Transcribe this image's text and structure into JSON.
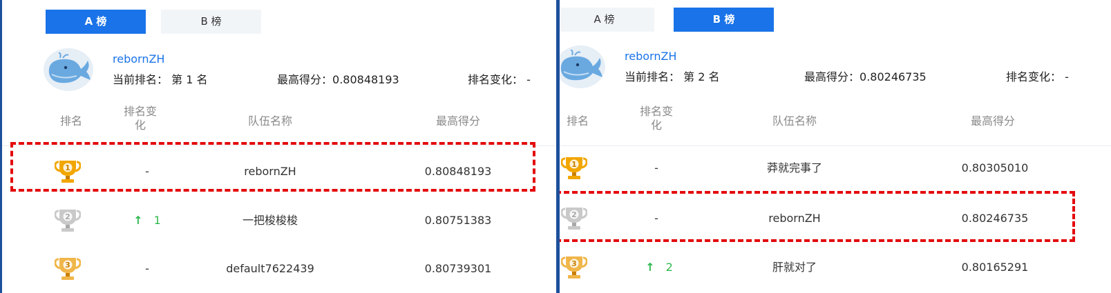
{
  "left": {
    "tabs": [
      {
        "label": "A 榜",
        "active": true
      },
      {
        "label": "B 榜",
        "active": false
      }
    ],
    "user": {
      "name": "rebornZH",
      "rank_label": "当前排名：",
      "rank_value": "第 1 名",
      "best_label": "最高得分：",
      "best_value": "0.80848193",
      "change_label": "排名变化：",
      "change_value": "-"
    },
    "headers": {
      "rank": "排名",
      "change_line1": "排名变",
      "change_line2": "化",
      "team": "队伍名称",
      "score": "最高得分"
    },
    "rows": [
      {
        "medal": "gold",
        "medal_number": "1",
        "change_arrow": "",
        "change": "-",
        "team": "rebornZH",
        "score": "0.80848193"
      },
      {
        "medal": "silver",
        "medal_number": "2",
        "change_arrow": "↑",
        "change": "1",
        "team": "一把梭梭梭",
        "score": "0.80751383"
      },
      {
        "medal": "bronze",
        "medal_number": "3",
        "change_arrow": "",
        "change": "-",
        "team": "default7622439",
        "score": "0.80739301"
      }
    ]
  },
  "right": {
    "tabs": [
      {
        "label": "A 榜",
        "active": false
      },
      {
        "label": "B 榜",
        "active": true
      }
    ],
    "user": {
      "name": "rebornZH",
      "rank_label": "当前排名：",
      "rank_value": "第 2 名",
      "best_label": "最高得分：",
      "best_value": "0.80246735",
      "change_label": "排名变化：",
      "change_value": "-"
    },
    "headers": {
      "rank": "排名",
      "change_line1": "排名变",
      "change_line2": "化",
      "team": "队伍名称",
      "score": "最高得分"
    },
    "rows": [
      {
        "medal": "gold",
        "medal_number": "1",
        "change_arrow": "",
        "change": "-",
        "team": "莽就完事了",
        "score": "0.80305010"
      },
      {
        "medal": "silver",
        "medal_number": "2",
        "change_arrow": "",
        "change": "-",
        "team": "rebornZH",
        "score": "0.80246735"
      },
      {
        "medal": "bronze",
        "medal_number": "3",
        "change_arrow": "↑",
        "change": "2",
        "team": "肝就对了",
        "score": "0.80165291"
      }
    ]
  },
  "colors": {
    "accent": "#1a73e8",
    "highlight": "#e3090b",
    "rank_up": "#2db84d",
    "gold": "#f2a600",
    "silver": "#c9c9c9",
    "bronze": "#f0b64a"
  },
  "icons": {
    "avatar": "whale-icon",
    "medal": "trophy-icon",
    "rank_up": "arrow-up-icon"
  }
}
